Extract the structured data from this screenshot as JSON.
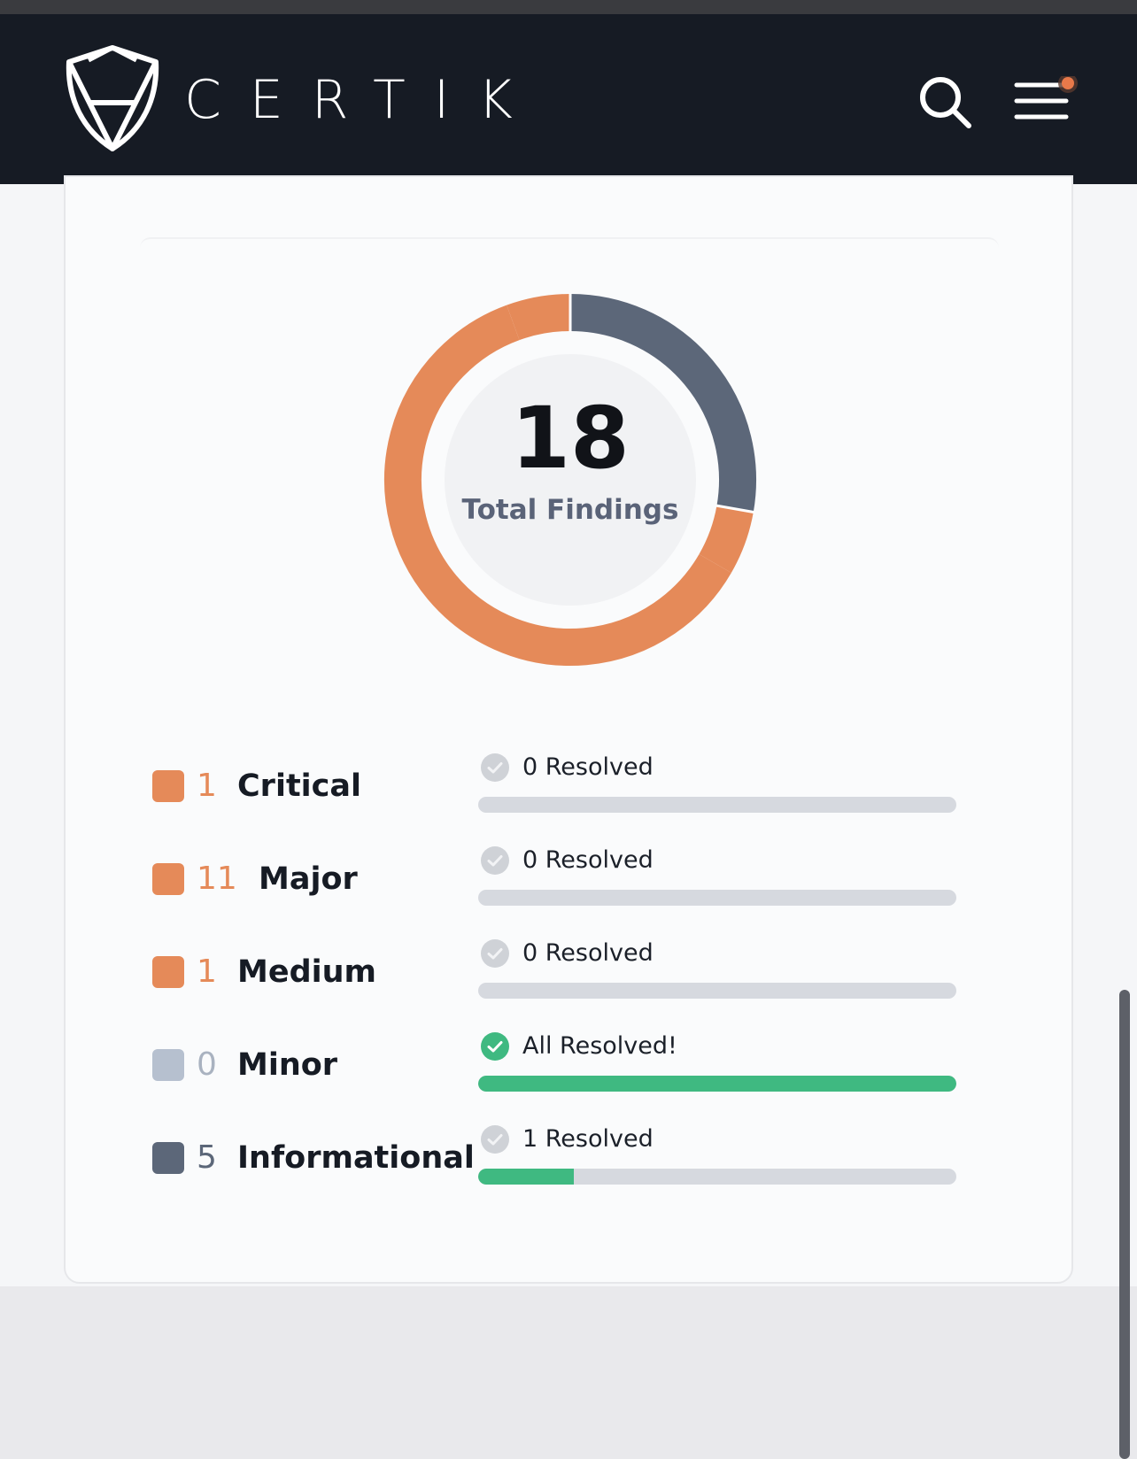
{
  "header": {
    "brand": "CERTIK",
    "icons": {
      "logo": "certik-shield-logo",
      "search": "search-icon",
      "menu": "hamburger-menu-icon",
      "notification": "notification-dot"
    },
    "colors": {
      "background": "#161b24",
      "notification_dot": "#e8794a"
    }
  },
  "summary": {
    "total": "18",
    "total_label": "Total Findings"
  },
  "chart_data": {
    "type": "pie",
    "total": 18,
    "segments": [
      {
        "name": "Critical",
        "value": 1,
        "color": "#e58a59"
      },
      {
        "name": "Major",
        "value": 11,
        "color": "#e58a59"
      },
      {
        "name": "Medium",
        "value": 1,
        "color": "#e58a59"
      },
      {
        "name": "Minor",
        "value": 0,
        "color": "#b6c0cf"
      },
      {
        "name": "Informational",
        "value": 5,
        "color": "#5c6779"
      }
    ]
  },
  "findings": [
    {
      "label": "Critical",
      "count": "1",
      "status": "0 Resolved",
      "resolved_fraction": 0,
      "swatch": "#e58a59",
      "count_color": "#e58a59",
      "status_icon": "check-circle-gray-icon"
    },
    {
      "label": "Major",
      "count": "11",
      "status": "0 Resolved",
      "resolved_fraction": 0,
      "swatch": "#e58a59",
      "count_color": "#e58a59",
      "status_icon": "check-circle-gray-icon"
    },
    {
      "label": "Medium",
      "count": "1",
      "status": "0 Resolved",
      "resolved_fraction": 0,
      "swatch": "#e58a59",
      "count_color": "#e58a59",
      "status_icon": "check-circle-gray-icon"
    },
    {
      "label": "Minor",
      "count": "0",
      "status": "All Resolved!",
      "resolved_fraction": 1,
      "swatch": "#b6c0cf",
      "count_color": "#a9b2c0",
      "status_icon": "check-circle-green-icon"
    },
    {
      "label": "Informational",
      "count": "5",
      "status": "1 Resolved",
      "resolved_fraction": 0.2,
      "swatch": "#5c6779",
      "count_color": "#5c6779",
      "status_icon": "check-circle-gray-icon"
    }
  ],
  "colors": {
    "resolved_bar": "#3fb981",
    "track": "#d6d9df"
  }
}
